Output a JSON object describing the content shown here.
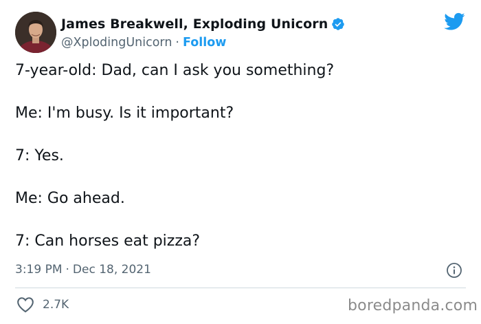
{
  "author": {
    "display_name": "James Breakwell, Exploding Unicorn",
    "handle": "@XplodingUnicorn",
    "separator": "·",
    "follow_label": "Follow",
    "verified": true
  },
  "tweet": {
    "lines": [
      "7-year-old: Dad, can I ask you something?",
      "Me: I'm busy. Is it important?",
      "7: Yes.",
      "Me: Go ahead.",
      "7: Can horses eat pizza?"
    ],
    "time": "3:19 PM",
    "date_separator": "·",
    "date": "Dec 18, 2021",
    "likes": "2.7K"
  },
  "icons": {
    "verified": "verified-badge-icon",
    "platform": "twitter-bird-icon",
    "info": "info-icon",
    "like": "heart-icon"
  },
  "colors": {
    "accent": "#1d9bf0",
    "text": "#0f1419",
    "secondary": "#536471",
    "divider": "#cfd9de"
  },
  "watermark": "boredpanda.com"
}
